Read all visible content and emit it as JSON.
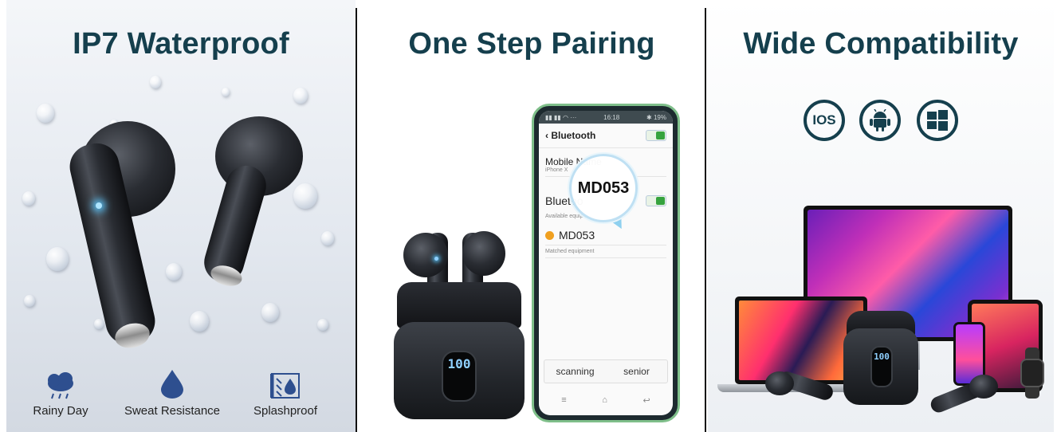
{
  "panels": {
    "waterproof": {
      "title": "IP7 Waterproof",
      "features": [
        {
          "icon": "rain-cloud-icon",
          "label": "Rainy Day"
        },
        {
          "icon": "water-drop-icon",
          "label": "Sweat Resistance"
        },
        {
          "icon": "splash-icon",
          "label": "Splashproof"
        }
      ]
    },
    "pairing": {
      "title": "One Step Pairing",
      "phone": {
        "status_time": "16:18",
        "status_battery": "19%",
        "screen_title": "Bluetooth",
        "mobile_name_label": "Mobile Name",
        "mobile_name_value": "iPhone X",
        "bluetooth_label": "Bluetoo",
        "available_label": "Available equipm",
        "device_name": "MD053",
        "matched_label": "Matched equipment",
        "button_scanning": "scanning",
        "button_senior": "senior",
        "nav_menu": "≡",
        "nav_home": "⌂",
        "nav_back": "↩"
      },
      "magnifier_text": "MD053",
      "case_display": "100"
    },
    "compatibility": {
      "title": "Wide Compatibility",
      "os_icons": [
        {
          "icon": "ios-icon",
          "text": "IOS"
        },
        {
          "icon": "android-icon",
          "text": ""
        },
        {
          "icon": "windows-icon",
          "text": ""
        }
      ],
      "case_display": "100"
    }
  },
  "colors": {
    "heading": "#153f4d",
    "divider": "#111111",
    "led": "#8fd0ff"
  }
}
